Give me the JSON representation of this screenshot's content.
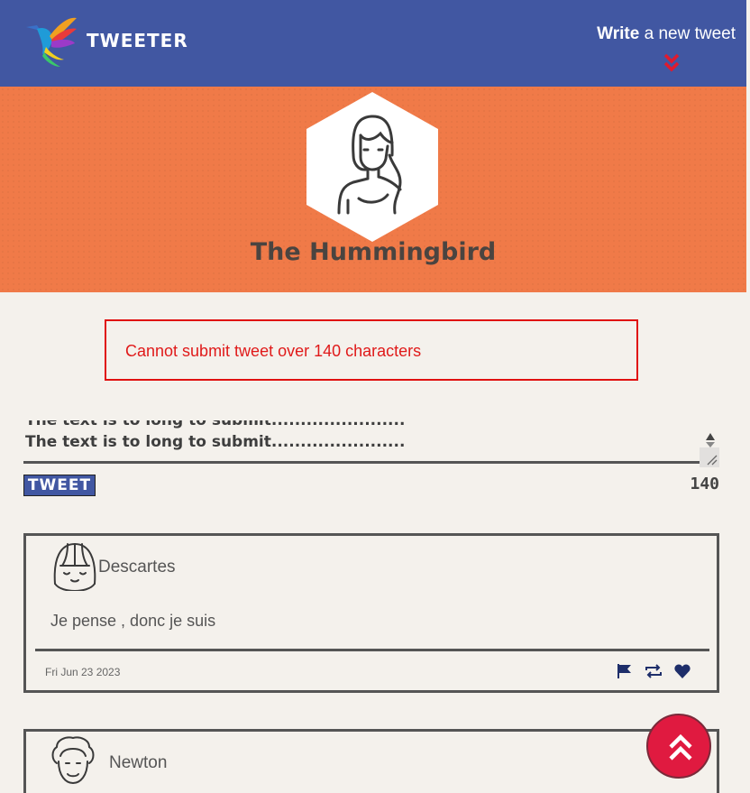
{
  "nav": {
    "brand": "TWEETER",
    "compose_strong": "Write",
    "compose_rest": " a new tweet",
    "colors": {
      "bar": "#4157a2",
      "arrow": "#e01a2e"
    }
  },
  "profile": {
    "name": "The Hummingbird",
    "background": "#f07a48"
  },
  "error": {
    "message": "Cannot submit tweet over 140 characters"
  },
  "composer": {
    "text_line_1": "The text is to long to submit.......................",
    "text_line_2": "The text is to long to submit.......................",
    "button_label": "TWEET",
    "counter": "140"
  },
  "tweets": [
    {
      "author": "Descartes",
      "content": "Je pense , donc je suis",
      "date": "Fri Jun 23 2023"
    },
    {
      "author": "Newton"
    }
  ],
  "icons": {
    "flag": "flag-icon",
    "retweet": "retweet-icon",
    "like": "heart-icon",
    "back_to_top": "double-chevron-up-icon"
  }
}
